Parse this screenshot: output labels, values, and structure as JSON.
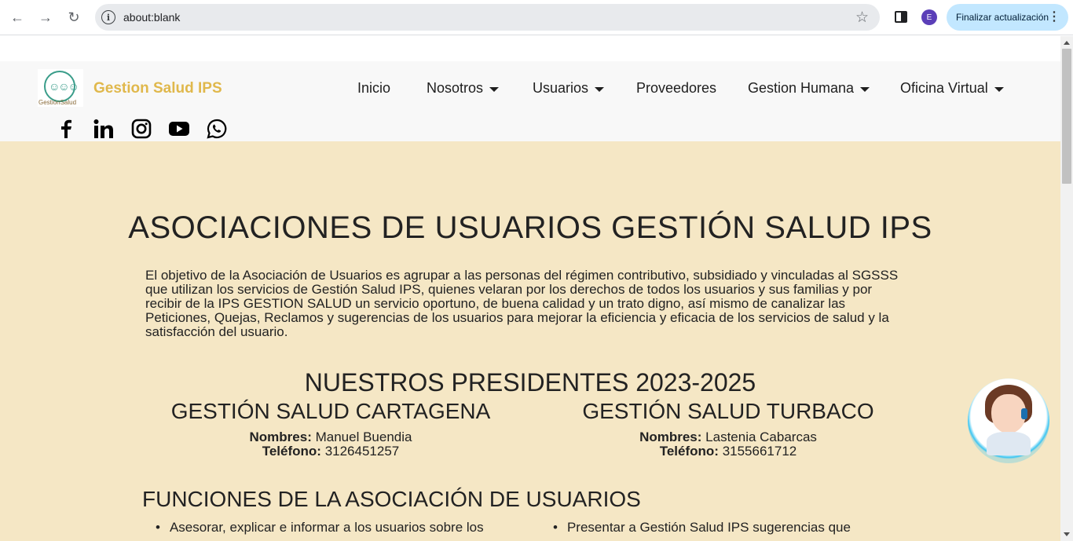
{
  "browser": {
    "url": "about:blank",
    "profile_initial": "E",
    "update_label": "Finalizar actualización"
  },
  "header": {
    "brand": "Gestion Salud IPS",
    "logo_text": "GestiónSalud",
    "nav": [
      {
        "label": "Inicio",
        "dropdown": false
      },
      {
        "label": "Nosotros",
        "dropdown": true
      },
      {
        "label": "Usuarios",
        "dropdown": true
      },
      {
        "label": "Proveedores",
        "dropdown": false
      },
      {
        "label": "Gestion Humana",
        "dropdown": true
      },
      {
        "label": "Oficina Virtual",
        "dropdown": true
      }
    ],
    "social": [
      "facebook-icon",
      "linkedin-icon",
      "instagram-icon",
      "youtube-icon",
      "whatsapp-icon"
    ]
  },
  "main": {
    "title": "ASOCIACIONES DE USUARIOS GESTIÓN SALUD IPS",
    "intro": "El objetivo de la Asociación de Usuarios es agrupar a las personas del régimen contributivo, subsidiado y vinculadas al SGSSS que utilizan los servicios de Gestión Salud IPS, quienes velaran por los derechos de todos los usuarios y sus familias y por recibir de la IPS GESTION SALUD un servicio oportuno, de buena calidad y un trato digno, así mismo de canalizar las Peticiones, Quejas, Reclamos y sugerencias de los usuarios para mejorar la eficiencia y eficacia de los servicios de salud y la satisfacción del usuario.",
    "presidents_title": "NUESTROS PRESIDENTES 2023-2025",
    "presidents": [
      {
        "place": "GESTIÓN SALUD CARTAGENA",
        "name_label": "Nombres:",
        "name": " Manuel Buendia",
        "phone_label": "Teléfono:",
        "phone": " 3126451257"
      },
      {
        "place": "GESTIÓN SALUD TURBACO",
        "name_label": "Nombres:",
        "name": " Lastenia Cabarcas",
        "phone_label": "Teléfono:",
        "phone": " 3155661712"
      }
    ],
    "functions_title": "FUNCIONES DE LA ASOCIACIÓN DE USUARIOS",
    "functions": [
      "Asesorar, explicar e informar a los usuarios sobre los",
      "Presentar a Gestión Salud IPS sugerencias que"
    ]
  },
  "colors": {
    "brand": "#e0b84c",
    "main_bg": "#f5e7c5",
    "header_bg": "#f8f8f8"
  }
}
